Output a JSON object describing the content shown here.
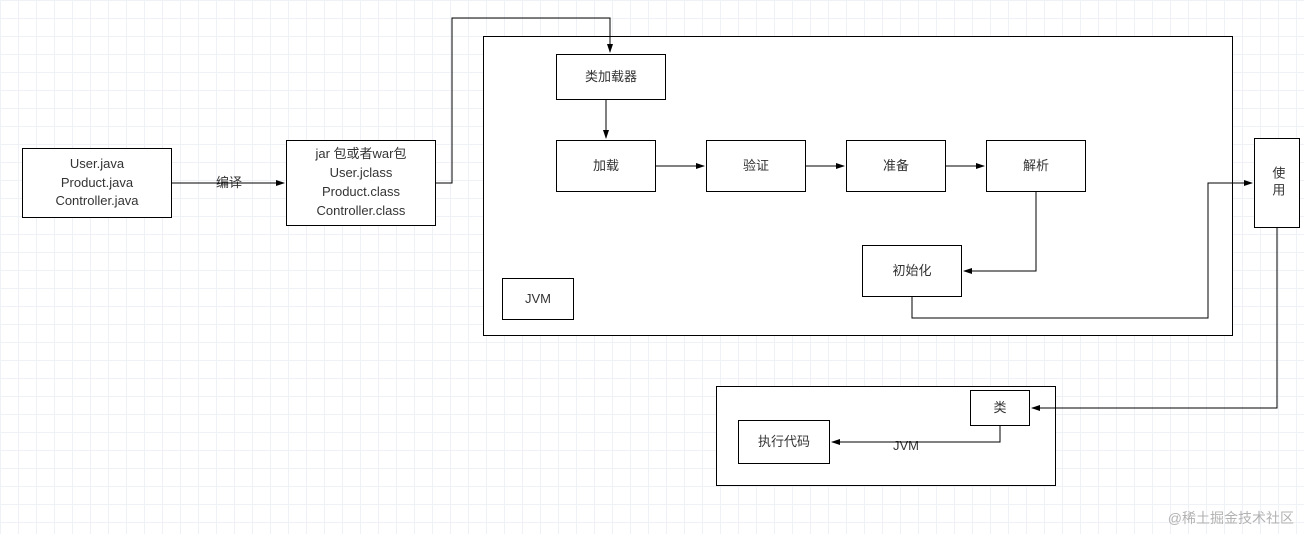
{
  "boxes": {
    "source": {
      "lines": [
        "User.java",
        "Product.java",
        "Controller.java"
      ]
    },
    "jar": {
      "lines": [
        "jar 包或者war包",
        "User.jclass",
        "Product.class",
        "Controller.class"
      ]
    },
    "classloader": "类加载器",
    "load": "加载",
    "verify": "验证",
    "prepare": "准备",
    "resolve": "解析",
    "init": "初始化",
    "jvm_label": "JVM",
    "use": "使用",
    "class": "类",
    "exec": "执行代码",
    "jvm2_label": "JVM"
  },
  "labels": {
    "compile": "编译"
  },
  "ui": {
    "watermark": "@稀土掘金技术社区"
  }
}
